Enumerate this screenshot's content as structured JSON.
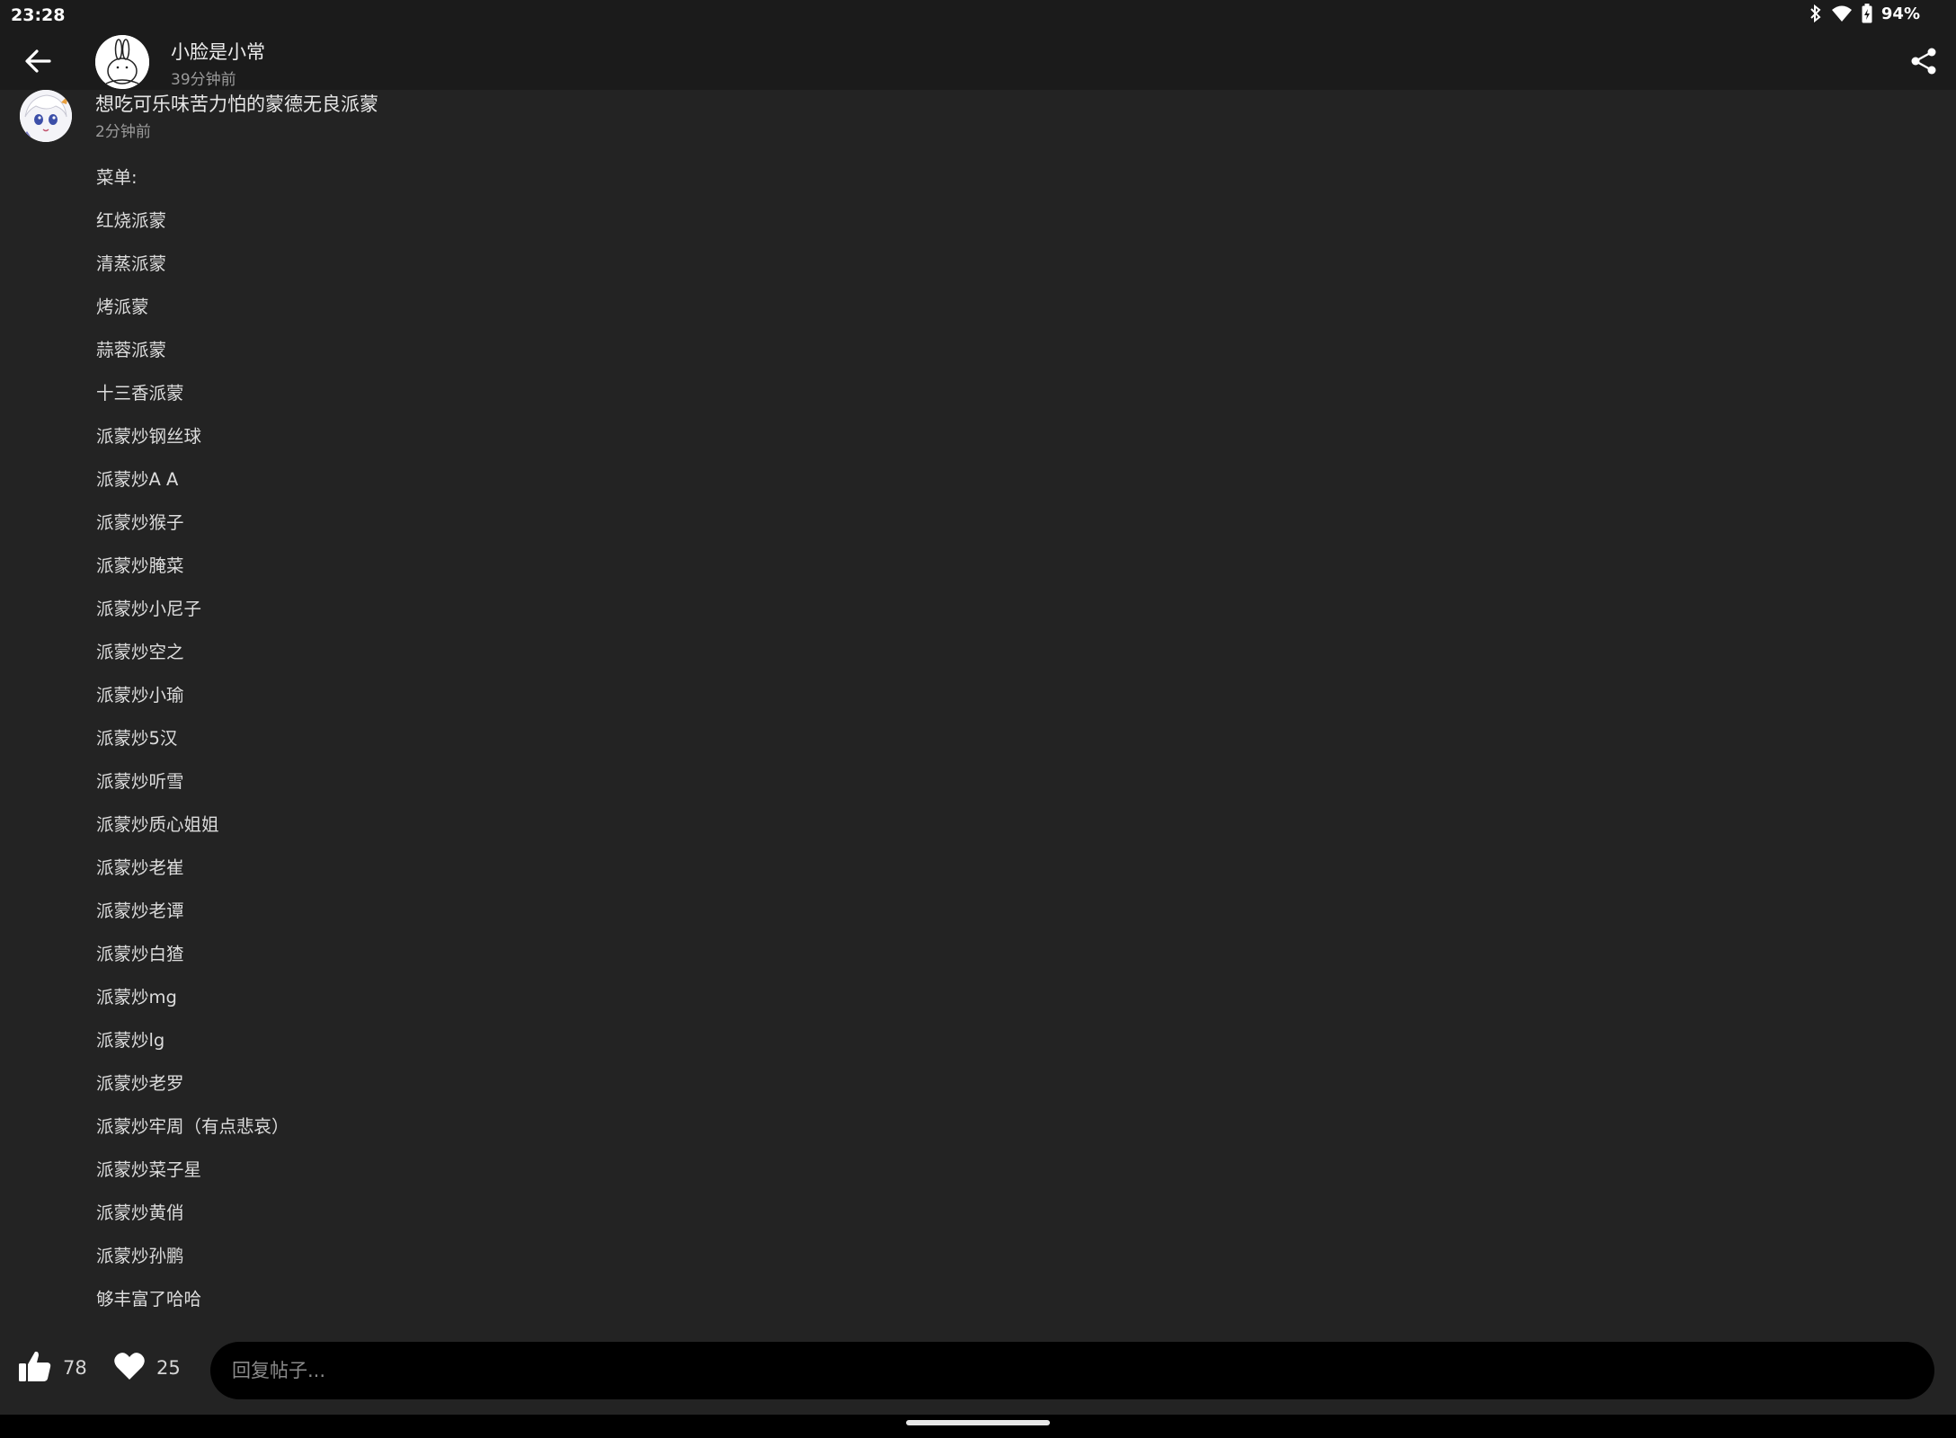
{
  "status_bar": {
    "time": "23:28",
    "battery_percent": "94%",
    "icons": [
      "bluetooth-icon",
      "wifi-icon",
      "battery-icon"
    ]
  },
  "header": {
    "author_name": "小脸是小常",
    "post_time": "39分钟前",
    "back_icon": "arrow-left-icon",
    "share_icon": "share-icon"
  },
  "reply": {
    "title": "想吃可乐味苦力怕的蒙德无良派蒙",
    "time": "2分钟前",
    "lines": [
      "菜单:",
      "红烧派蒙",
      "清蒸派蒙",
      "烤派蒙",
      "蒜蓉派蒙",
      "十三香派蒙",
      "派蒙炒钢丝球",
      "派蒙炒A A",
      "派蒙炒猴子",
      "派蒙炒腌菜",
      "派蒙炒小尼子",
      "派蒙炒空之",
      "派蒙炒小瑜",
      "派蒙炒5汉",
      "派蒙炒听雪",
      "派蒙炒质心姐姐",
      "派蒙炒老崔",
      "派蒙炒老谭",
      "派蒙炒白猹",
      "派蒙炒mg",
      "派蒙炒lg",
      "派蒙炒老罗",
      "派蒙炒牢周（有点悲哀）",
      "派蒙炒菜子星",
      "派蒙炒黄俏",
      "派蒙炒孙鹏",
      "够丰富了哈哈"
    ]
  },
  "bottom_bar": {
    "like_count": "78",
    "favorite_count": "25",
    "reply_placeholder": "回复帖子..."
  }
}
